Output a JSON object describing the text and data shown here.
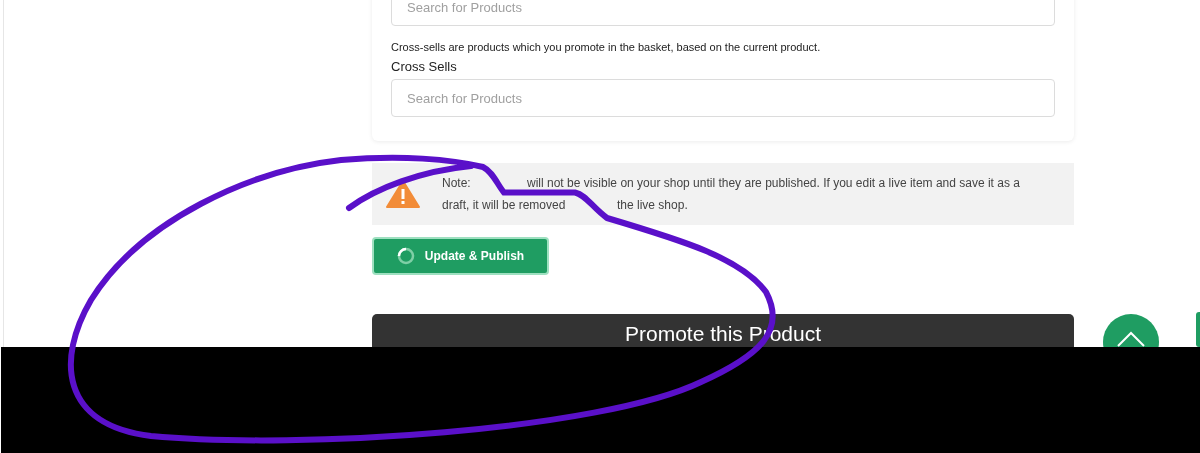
{
  "upsells_field": {
    "placeholder": "Search for Products"
  },
  "cross_sells": {
    "help": "Cross-sells are products which you promote in the basket, based on the current product.",
    "label": "Cross Sells",
    "placeholder": "Search for Products"
  },
  "notice": {
    "line_1_start": "Note:",
    "line_1_end": "will not be visible on your shop until they are published. If you edit a live item and save it as a",
    "line_2_start": "draft, it will be removed",
    "line_2_end": "the live shop."
  },
  "publish_button": {
    "label": "Update & Publish",
    "loading": true
  },
  "promote_panel": {
    "title": "Promote this Product"
  }
}
